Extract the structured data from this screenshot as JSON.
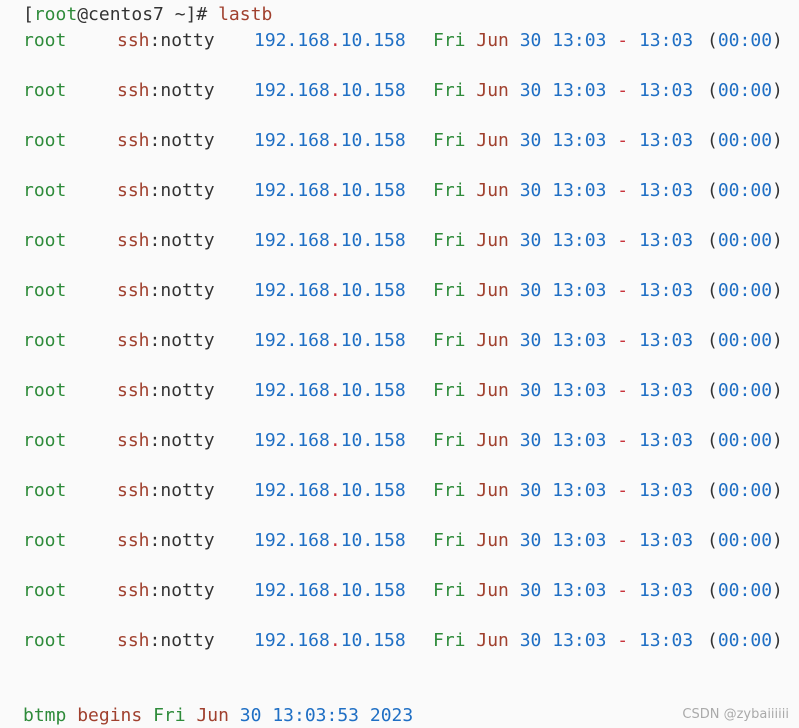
{
  "prompt": {
    "open_bracket": "[",
    "user": "root",
    "at_host": "@centos7 ~]# ",
    "command": "lastb"
  },
  "entries": [
    {
      "user": "root",
      "tty_proto": "ssh",
      "tty_rest": ":notty",
      "ip_a": "192.168",
      "ip_dot": ".",
      "ip_b": "10.158",
      "day": "Fri",
      "month": "Jun",
      "date": "30",
      "start": "13:03",
      "sep": "-",
      "end": "13:03",
      "duration": "(00:00)"
    },
    {
      "user": "root",
      "tty_proto": "ssh",
      "tty_rest": ":notty",
      "ip_a": "192.168",
      "ip_dot": ".",
      "ip_b": "10.158",
      "day": "Fri",
      "month": "Jun",
      "date": "30",
      "start": "13:03",
      "sep": "-",
      "end": "13:03",
      "duration": "(00:00)"
    },
    {
      "user": "root",
      "tty_proto": "ssh",
      "tty_rest": ":notty",
      "ip_a": "192.168",
      "ip_dot": ".",
      "ip_b": "10.158",
      "day": "Fri",
      "month": "Jun",
      "date": "30",
      "start": "13:03",
      "sep": "-",
      "end": "13:03",
      "duration": "(00:00)"
    },
    {
      "user": "root",
      "tty_proto": "ssh",
      "tty_rest": ":notty",
      "ip_a": "192.168",
      "ip_dot": ".",
      "ip_b": "10.158",
      "day": "Fri",
      "month": "Jun",
      "date": "30",
      "start": "13:03",
      "sep": "-",
      "end": "13:03",
      "duration": "(00:00)"
    },
    {
      "user": "root",
      "tty_proto": "ssh",
      "tty_rest": ":notty",
      "ip_a": "192.168",
      "ip_dot": ".",
      "ip_b": "10.158",
      "day": "Fri",
      "month": "Jun",
      "date": "30",
      "start": "13:03",
      "sep": "-",
      "end": "13:03",
      "duration": "(00:00)"
    },
    {
      "user": "root",
      "tty_proto": "ssh",
      "tty_rest": ":notty",
      "ip_a": "192.168",
      "ip_dot": ".",
      "ip_b": "10.158",
      "day": "Fri",
      "month": "Jun",
      "date": "30",
      "start": "13:03",
      "sep": "-",
      "end": "13:03",
      "duration": "(00:00)"
    },
    {
      "user": "root",
      "tty_proto": "ssh",
      "tty_rest": ":notty",
      "ip_a": "192.168",
      "ip_dot": ".",
      "ip_b": "10.158",
      "day": "Fri",
      "month": "Jun",
      "date": "30",
      "start": "13:03",
      "sep": "-",
      "end": "13:03",
      "duration": "(00:00)"
    },
    {
      "user": "root",
      "tty_proto": "ssh",
      "tty_rest": ":notty",
      "ip_a": "192.168",
      "ip_dot": ".",
      "ip_b": "10.158",
      "day": "Fri",
      "month": "Jun",
      "date": "30",
      "start": "13:03",
      "sep": "-",
      "end": "13:03",
      "duration": "(00:00)"
    },
    {
      "user": "root",
      "tty_proto": "ssh",
      "tty_rest": ":notty",
      "ip_a": "192.168",
      "ip_dot": ".",
      "ip_b": "10.158",
      "day": "Fri",
      "month": "Jun",
      "date": "30",
      "start": "13:03",
      "sep": "-",
      "end": "13:03",
      "duration": "(00:00)"
    },
    {
      "user": "root",
      "tty_proto": "ssh",
      "tty_rest": ":notty",
      "ip_a": "192.168",
      "ip_dot": ".",
      "ip_b": "10.158",
      "day": "Fri",
      "month": "Jun",
      "date": "30",
      "start": "13:03",
      "sep": "-",
      "end": "13:03",
      "duration": "(00:00)"
    },
    {
      "user": "root",
      "tty_proto": "ssh",
      "tty_rest": ":notty",
      "ip_a": "192.168",
      "ip_dot": ".",
      "ip_b": "10.158",
      "day": "Fri",
      "month": "Jun",
      "date": "30",
      "start": "13:03",
      "sep": "-",
      "end": "13:03",
      "duration": "(00:00)"
    },
    {
      "user": "root",
      "tty_proto": "ssh",
      "tty_rest": ":notty",
      "ip_a": "192.168",
      "ip_dot": ".",
      "ip_b": "10.158",
      "day": "Fri",
      "month": "Jun",
      "date": "30",
      "start": "13:03",
      "sep": "-",
      "end": "13:03",
      "duration": "(00:00)"
    },
    {
      "user": "root",
      "tty_proto": "ssh",
      "tty_rest": ":notty",
      "ip_a": "192.168",
      "ip_dot": ".",
      "ip_b": "10.158",
      "day": "Fri",
      "month": "Jun",
      "date": "30",
      "start": "13:03",
      "sep": "-",
      "end": "13:03",
      "duration": "(00:00)"
    }
  ],
  "footer": {
    "word1": "btmp",
    "word2": "begins",
    "day": "Fri",
    "month": "Jun",
    "date": "30",
    "time": "13:03:53",
    "year": "2023"
  },
  "watermark": "CSDN @zybaiiiiii",
  "colors": {
    "background": "#fafafa",
    "text": "#333333",
    "green": "#2e8b3a",
    "brown": "#a0402e",
    "blue": "#1f6fc4",
    "red": "#c8323a"
  }
}
